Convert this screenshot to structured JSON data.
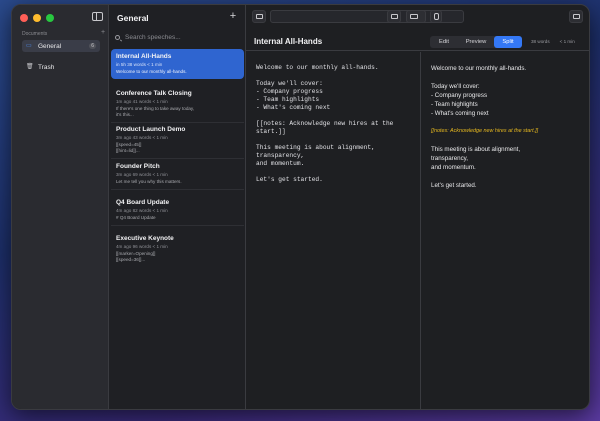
{
  "sidebar": {
    "section_label": "Documents",
    "add_symbol": "+",
    "items": [
      {
        "label": "General",
        "count": "6",
        "icon": "folder-icon",
        "active": true
      },
      {
        "label": "Trash",
        "icon": "trash-icon",
        "active": false
      }
    ]
  },
  "list": {
    "title": "General",
    "add_symbol": "+",
    "search_placeholder": "Search speeches...",
    "cards": [
      {
        "title": "Internal All-Hands",
        "meta": "in 5h   38 words   < 1 min",
        "preview": "Welcome to our monthly all-hands."
      },
      {
        "title": "Conference Talk Closing",
        "meta": "1m ago   41 words   < 1 min",
        "preview": "If there's one thing to take away today,\nit's this..."
      },
      {
        "title": "Product Launch Demo",
        "meta": "3m ago   43 words   < 1 min",
        "preview": "[[speed=45]]\n[[hint=lid]]..."
      },
      {
        "title": "Founder Pitch",
        "meta": "3m ago   69 words   < 1 min",
        "preview": "Let me tell you why this matters."
      },
      {
        "title": "Q4 Board Update",
        "meta": "4m ago   82 words   < 1 min",
        "preview": "# Q4 Board Update"
      },
      {
        "title": "Executive Keynote",
        "meta": "4m ago   96 words   < 1 min",
        "preview": "[[marker=Opening]]\n[[speed=36]]..."
      }
    ]
  },
  "editor": {
    "title": "Internal All-Hands",
    "modes": [
      "Edit",
      "Preview",
      "Split"
    ],
    "active_mode": "Split",
    "word_count": "38 words",
    "read_time": "< 1 min",
    "source": "Welcome to our monthly all-hands.\n\nToday we'll cover:\n- Company progress\n- Team highlights\n- What's coming next\n\n[[notes: Acknowledge new hires at the start.]]\n\nThis meeting is about alignment,\ntransparency,\nand momentum.\n\nLet's get started.",
    "preview": {
      "p1": "Welcome to our monthly all-hands.",
      "p2_lines": [
        "Today we'll cover:",
        "- Company progress",
        "- Team highlights",
        "- What's coming next"
      ],
      "note": "[[notes: Acknowledge new hires at the start.]]",
      "p3_lines": [
        "This meeting is about alignment,",
        "transparency,",
        "and momentum."
      ],
      "p4": "Let's get started."
    }
  },
  "colors": {
    "accent": "#3478f6",
    "selected_card": "#2f65d0",
    "note": "#e6b820"
  }
}
